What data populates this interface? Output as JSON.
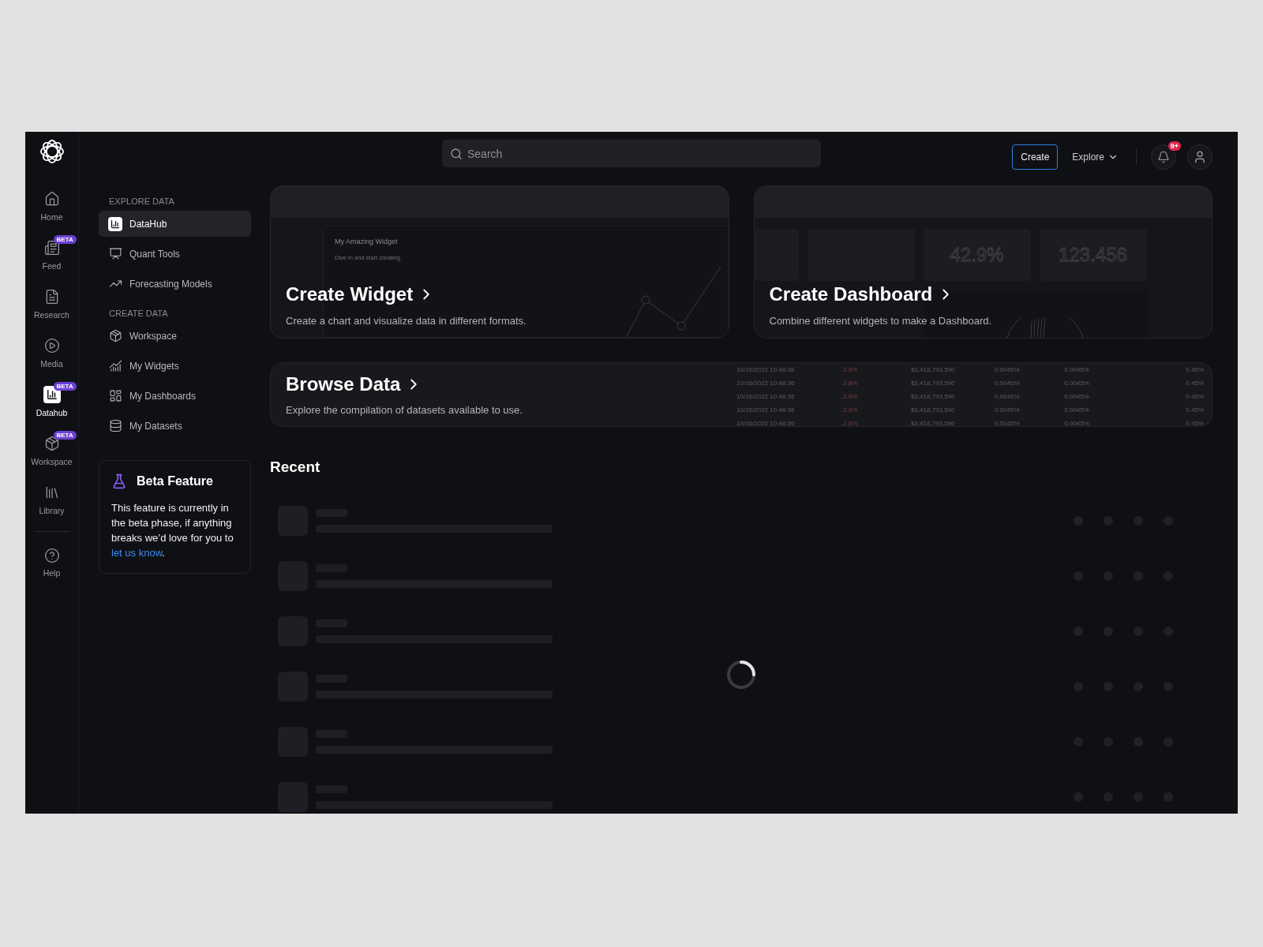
{
  "rail": {
    "items": [
      {
        "label": "Home",
        "selected": false
      },
      {
        "label": "Feed",
        "selected": false,
        "badge": "BETA"
      },
      {
        "label": "Research",
        "selected": false
      },
      {
        "label": "Media",
        "selected": false
      },
      {
        "label": "Datahub",
        "selected": true,
        "badge": "BETA"
      },
      {
        "label": "Workspace",
        "selected": false,
        "badge": "BETA"
      },
      {
        "label": "Library",
        "selected": false
      }
    ],
    "help": {
      "label": "Help"
    }
  },
  "topbar": {
    "search": {
      "placeholder": "Search"
    },
    "create_button": "Create",
    "explore_menu": "Explore",
    "notification_count": "9+"
  },
  "sidebar": {
    "sections": [
      {
        "title": "EXPLORE DATA",
        "items": [
          {
            "label": "DataHub",
            "selected": true
          },
          {
            "label": "Quant Tools",
            "selected": false
          },
          {
            "label": "Forecasting Models",
            "selected": false
          }
        ]
      },
      {
        "title": "CREATE DATA",
        "items": [
          {
            "label": "Workspace",
            "selected": false
          },
          {
            "label": "My Widgets",
            "selected": false
          },
          {
            "label": "My Dashboards",
            "selected": false
          },
          {
            "label": "My Datasets",
            "selected": false
          }
        ]
      }
    ],
    "beta_card": {
      "title": "Beta Feature",
      "text": "This feature is currently in the beta phase, if anything breaks we’d love for you to",
      "link": "let us know",
      "end": "."
    }
  },
  "cards": [
    {
      "kind": "widget",
      "title": "Create Widget",
      "description": "Create a chart and visualize data  in different formats.",
      "preview_title": "My Amazing Widget",
      "preview_subtitle": "Dive in and start creating."
    },
    {
      "kind": "dashboard",
      "title": "Create Dashboard",
      "description": "Combine different widgets to make a Dashboard.",
      "preview_values": [
        "42.9%",
        "123.456"
      ]
    }
  ],
  "browse": {
    "title": "Browse Data",
    "description": "Explore the compilation of datasets available to use.",
    "preview_rows": [
      [
        "10/16/2022 10:48:36",
        "-2.8%",
        "$3,418,793,590",
        "0.0045%",
        "0.0045%",
        "0.45%"
      ],
      [
        "10/16/2022 10:48:36",
        "-2.8%",
        "$3,418,793,590",
        "0.0045%",
        "0.0045%",
        "0.45%"
      ],
      [
        "10/16/2022 10:48:36",
        "-2.8%",
        "$3,418,793,590",
        "0.0045%",
        "0.0045%",
        "0.45%"
      ],
      [
        "10/16/2022 10:48:36",
        "-2.8%",
        "$3,418,793,590",
        "0.0045%",
        "0.0045%",
        "0.45%"
      ],
      [
        "10/16/2022 10:48:36",
        "-2.8%",
        "$3,418,793,590",
        "0.0045%",
        "0.0045%",
        "0.45%"
      ]
    ]
  },
  "recent": {
    "title": "Recent",
    "loading": true
  }
}
